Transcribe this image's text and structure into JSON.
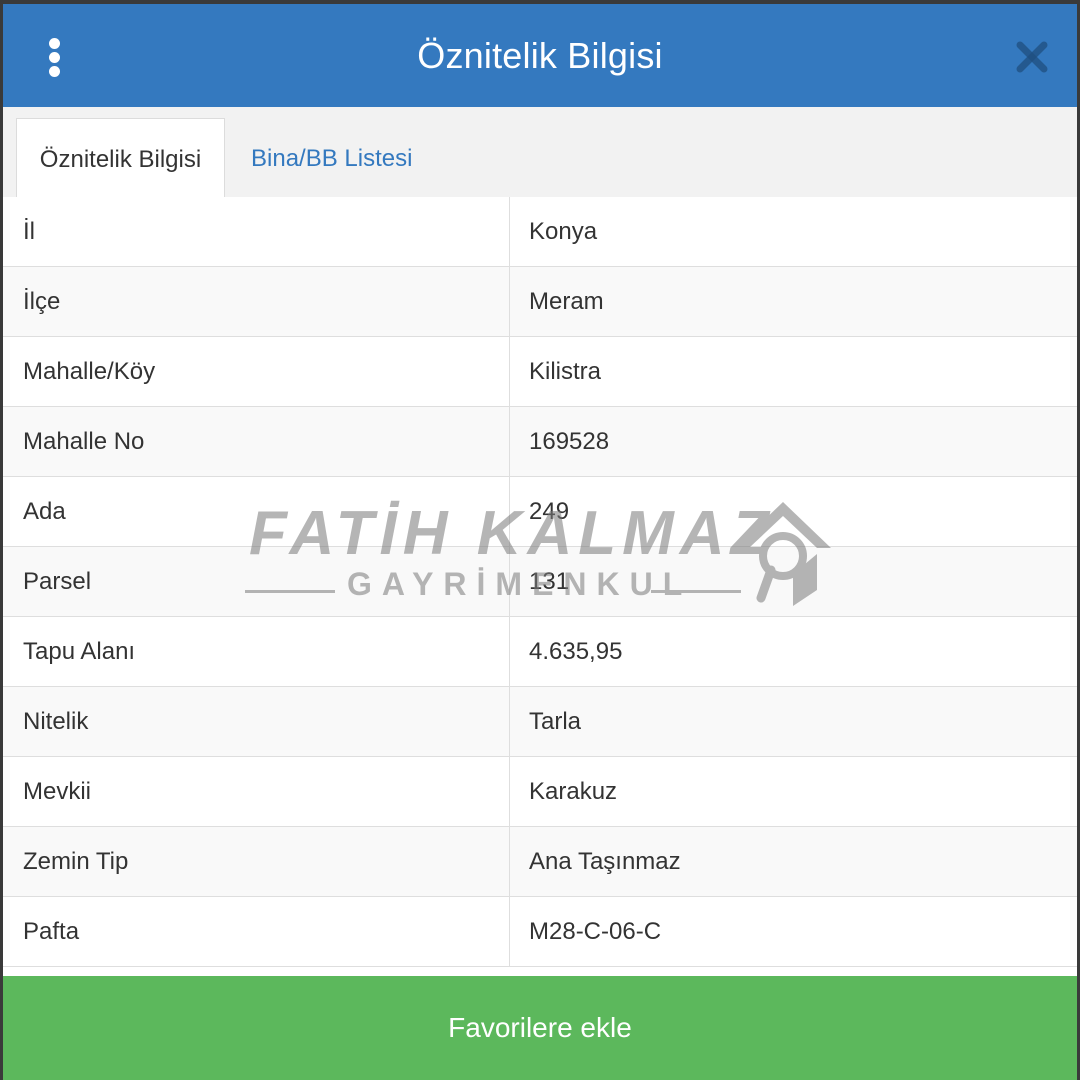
{
  "header": {
    "title": "Öznitelik Bilgisi",
    "menu_icon": "kebab-menu-icon",
    "close_icon": "close-icon"
  },
  "tabs": [
    {
      "label": "Öznitelik Bilgisi",
      "active": true
    },
    {
      "label": "Bina/BB Listesi",
      "active": false
    }
  ],
  "rows": [
    {
      "label": "İl",
      "value": "Konya"
    },
    {
      "label": "İlçe",
      "value": "Meram"
    },
    {
      "label": "Mahalle/Köy",
      "value": "Kilistra"
    },
    {
      "label": "Mahalle No",
      "value": "169528"
    },
    {
      "label": "Ada",
      "value": "249"
    },
    {
      "label": "Parsel",
      "value": "131"
    },
    {
      "label": "Tapu Alanı",
      "value": "4.635,95"
    },
    {
      "label": "Nitelik",
      "value": "Tarla"
    },
    {
      "label": "Mevkii",
      "value": "Karakuz"
    },
    {
      "label": "Zemin Tip",
      "value": "Ana Taşınmaz"
    },
    {
      "label": "Pafta",
      "value": "M28-C-06-C"
    }
  ],
  "watermark": {
    "main": "FATİH KALMAZ",
    "sub": "GAYRİMENKUL"
  },
  "footer": {
    "button_label": "Favorilere ekle"
  },
  "colors": {
    "header_bg": "#3479bf",
    "footer_bg": "#5cb85c",
    "tab_link": "#3479bf"
  }
}
